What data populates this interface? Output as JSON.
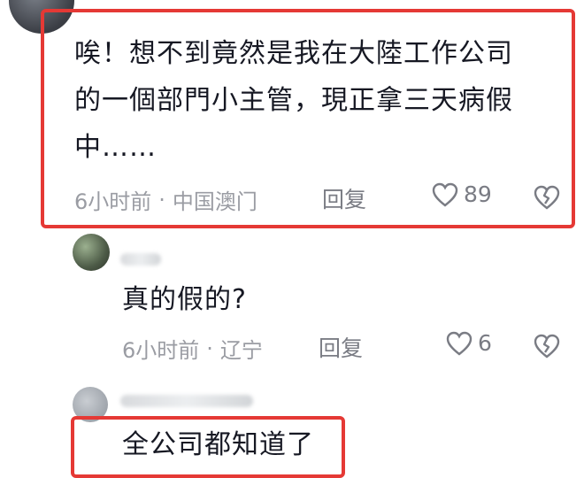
{
  "comment_main": {
    "text_line1": "唉！想不到竟然是我在大陸工作公司",
    "text_line2": "的一個部門小主管，現正拿三天病假",
    "text_line3": "中……",
    "time": "6小时前",
    "dot": "·",
    "location": "中国澳门",
    "reply_label": "回复",
    "like_count": "89"
  },
  "reply_1": {
    "text": "真的假的?",
    "time": "6小时前",
    "dot": "·",
    "location": "辽宁",
    "reply_label": "回复",
    "like_count": "6"
  },
  "reply_2": {
    "text": "全公司都知道了"
  },
  "icons": {
    "like": "heart-outline-icon",
    "dislike": "broken-heart-icon"
  },
  "colors": {
    "highlight_border": "#e53935",
    "meta_text": "#9a9ca3",
    "body_text": "#161823"
  }
}
